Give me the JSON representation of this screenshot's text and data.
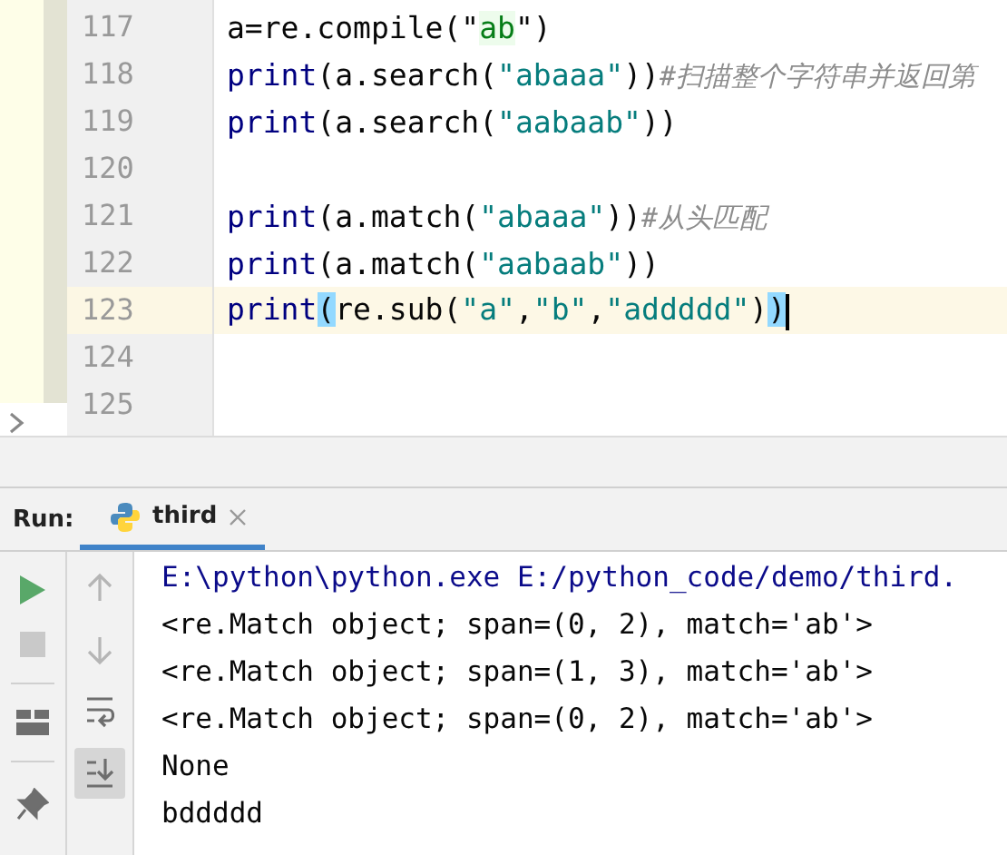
{
  "editor": {
    "lines": [
      {
        "number": "117",
        "current": false,
        "segments": [
          {
            "kind": "plain",
            "text": "a=re.compile(\""
          },
          {
            "kind": "regex",
            "text": "ab"
          },
          {
            "kind": "plain",
            "text": "\")"
          }
        ]
      },
      {
        "number": "118",
        "current": false,
        "segments": [
          {
            "kind": "keyword",
            "text": "print"
          },
          {
            "kind": "plain",
            "text": "(a.search("
          },
          {
            "kind": "string",
            "text": "\"abaaa\""
          },
          {
            "kind": "plain",
            "text": "))"
          },
          {
            "kind": "comment",
            "text": "#扫描整个字符串并返回第"
          }
        ]
      },
      {
        "number": "119",
        "current": false,
        "segments": [
          {
            "kind": "keyword",
            "text": "print"
          },
          {
            "kind": "plain",
            "text": "(a.search("
          },
          {
            "kind": "string",
            "text": "\"aabaab\""
          },
          {
            "kind": "plain",
            "text": "))"
          }
        ]
      },
      {
        "number": "120",
        "current": false
      },
      {
        "number": "121",
        "current": false,
        "segments": [
          {
            "kind": "keyword",
            "text": "print"
          },
          {
            "kind": "plain",
            "text": "(a.match("
          },
          {
            "kind": "string",
            "text": "\"abaaa\""
          },
          {
            "kind": "plain",
            "text": "))"
          },
          {
            "kind": "comment",
            "text": "#从头匹配"
          }
        ]
      },
      {
        "number": "122",
        "current": false,
        "segments": [
          {
            "kind": "keyword",
            "text": "print"
          },
          {
            "kind": "plain",
            "text": "(a.match("
          },
          {
            "kind": "string",
            "text": "\"aabaab\""
          },
          {
            "kind": "plain",
            "text": "))"
          }
        ]
      },
      {
        "number": "123",
        "current": true,
        "segments": [
          {
            "kind": "keyword",
            "text": "print"
          },
          {
            "kind": "brace",
            "text": "("
          },
          {
            "kind": "plain",
            "text": "re.sub("
          },
          {
            "kind": "string",
            "text": "\"a\""
          },
          {
            "kind": "plain",
            "text": ","
          },
          {
            "kind": "string",
            "text": "\"b\""
          },
          {
            "kind": "plain",
            "text": ","
          },
          {
            "kind": "string",
            "text": "\"addddd\""
          },
          {
            "kind": "plain",
            "text": ")"
          },
          {
            "kind": "brace",
            "text": ")"
          }
        ]
      },
      {
        "number": "124",
        "current": false
      },
      {
        "number": "125",
        "current": false
      }
    ]
  },
  "run_panel": {
    "label": "Run:",
    "tabs": [
      {
        "label": "third",
        "selected": true
      }
    ],
    "tools": [
      {
        "kind": "up",
        "on": false
      },
      {
        "kind": "down",
        "on": false
      },
      {
        "kind": "wrap",
        "on": false
      },
      {
        "kind": "scroll-end",
        "on": true
      }
    ],
    "console": [
      {
        "kind": "command",
        "text": "E:\\python\\python.exe E:/python_code/demo/third."
      },
      {
        "kind": "output",
        "text": "<re.Match object; span=(0, 2), match='ab'>"
      },
      {
        "kind": "output",
        "text": "<re.Match object; span=(1, 3), match='ab'>"
      },
      {
        "kind": "output",
        "text": "<re.Match object; span=(0, 2), match='ab'>"
      },
      {
        "kind": "output",
        "text": "None"
      },
      {
        "kind": "output",
        "text": "bddddd"
      }
    ]
  }
}
